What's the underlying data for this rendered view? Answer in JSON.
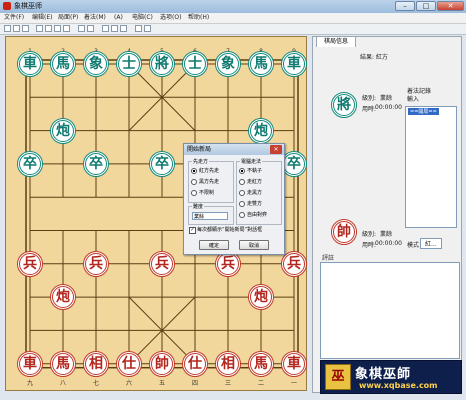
{
  "window": {
    "title": "象棋巫师",
    "minimize": "–",
    "maximize": "□",
    "close": "✕"
  },
  "menu": [
    "文件(F)",
    "编辑(E)",
    "局面(P)",
    "着法(M)",
    "(A)",
    "电脑(C)",
    "选项(O)",
    "帮助(H)"
  ],
  "board": {
    "top_coords": [
      "1",
      "2",
      "3",
      "4",
      "5",
      "6",
      "7",
      "8",
      "9"
    ],
    "bottom_coords": [
      "九",
      "八",
      "七",
      "六",
      "五",
      "四",
      "三",
      "二",
      "一"
    ],
    "pieces": [
      {
        "c": "車",
        "side": "green",
        "file": 0,
        "rank": 0
      },
      {
        "c": "馬",
        "side": "green",
        "file": 1,
        "rank": 0
      },
      {
        "c": "象",
        "side": "green",
        "file": 2,
        "rank": 0
      },
      {
        "c": "士",
        "side": "green",
        "file": 3,
        "rank": 0
      },
      {
        "c": "將",
        "side": "green",
        "file": 4,
        "rank": 0
      },
      {
        "c": "士",
        "side": "green",
        "file": 5,
        "rank": 0
      },
      {
        "c": "象",
        "side": "green",
        "file": 6,
        "rank": 0
      },
      {
        "c": "馬",
        "side": "green",
        "file": 7,
        "rank": 0
      },
      {
        "c": "車",
        "side": "green",
        "file": 8,
        "rank": 0
      },
      {
        "c": "炮",
        "side": "green",
        "file": 1,
        "rank": 2
      },
      {
        "c": "炮",
        "side": "green",
        "file": 7,
        "rank": 2
      },
      {
        "c": "卒",
        "side": "green",
        "file": 0,
        "rank": 3
      },
      {
        "c": "卒",
        "side": "green",
        "file": 2,
        "rank": 3
      },
      {
        "c": "卒",
        "side": "green",
        "file": 4,
        "rank": 3
      },
      {
        "c": "卒",
        "side": "green",
        "file": 6,
        "rank": 3
      },
      {
        "c": "卒",
        "side": "green",
        "file": 8,
        "rank": 3
      },
      {
        "c": "兵",
        "side": "red",
        "file": 0,
        "rank": 6
      },
      {
        "c": "兵",
        "side": "red",
        "file": 2,
        "rank": 6
      },
      {
        "c": "兵",
        "side": "red",
        "file": 4,
        "rank": 6
      },
      {
        "c": "兵",
        "side": "red",
        "file": 6,
        "rank": 6
      },
      {
        "c": "兵",
        "side": "red",
        "file": 8,
        "rank": 6
      },
      {
        "c": "炮",
        "side": "red",
        "file": 1,
        "rank": 7
      },
      {
        "c": "炮",
        "side": "red",
        "file": 7,
        "rank": 7
      },
      {
        "c": "車",
        "side": "red",
        "file": 0,
        "rank": 9
      },
      {
        "c": "馬",
        "side": "red",
        "file": 1,
        "rank": 9
      },
      {
        "c": "相",
        "side": "red",
        "file": 2,
        "rank": 9
      },
      {
        "c": "仕",
        "side": "red",
        "file": 3,
        "rank": 9
      },
      {
        "c": "帥",
        "side": "red",
        "file": 4,
        "rank": 9
      },
      {
        "c": "仕",
        "side": "red",
        "file": 5,
        "rank": 9
      },
      {
        "c": "相",
        "side": "red",
        "file": 6,
        "rank": 9
      },
      {
        "c": "馬",
        "side": "red",
        "file": 7,
        "rank": 9
      },
      {
        "c": "車",
        "side": "red",
        "file": 8,
        "rank": 9
      }
    ]
  },
  "panel": {
    "tab": "棋局信息",
    "result_label": "結果: 紅方",
    "black_piece": "將",
    "red_piece": "帥",
    "black_level_label": "級別:",
    "black_level_value": "業餘",
    "black_time_label": "用時:",
    "black_time_value": "00:00:00",
    "red_level_label": "級別:",
    "red_level_value": "業餘",
    "red_time_label": "用時:",
    "red_time_value": "00:00:00",
    "moves_header": "着法記錄",
    "moves_sub": "輸入",
    "move_item": "==開局==",
    "mode_label": "模式",
    "mode_value": "紅...",
    "notes_label": "評註"
  },
  "brand": {
    "logo": "巫",
    "name": "象棋巫師",
    "url": "www.xqbase.com"
  },
  "dialog": {
    "title": "開始新局",
    "group1_title": "先走方",
    "group1_options": [
      "紅方先走",
      "黑方先走",
      "不限制"
    ],
    "group2_title": "電腦走法",
    "group2_options": [
      "不執子",
      "走紅方",
      "走黑方",
      "走雙方",
      "自由對弈"
    ],
    "group3_title": "難度",
    "difficulty": "業餘",
    "checkbox_label": "每次都顯示“開始新局”對話框",
    "ok": "確定",
    "cancel": "取消"
  },
  "colors": {
    "board": "#f2d79c",
    "green_piece": "#0f7a70",
    "red_piece": "#b3261e"
  }
}
